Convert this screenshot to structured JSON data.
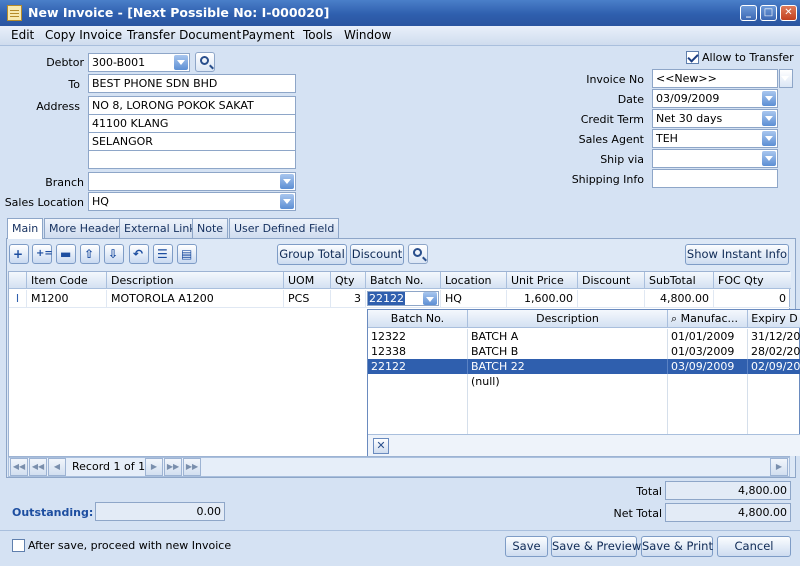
{
  "window": {
    "title": "New Invoice - [Next Possible No: I-000020]",
    "min": "_",
    "max": "□",
    "close": "✕"
  },
  "menu": [
    "Edit",
    "Copy Invoice",
    "Transfer Document",
    "Payment",
    "Tools",
    "Window"
  ],
  "header": {
    "debtor_label": "Debtor",
    "debtor": "300-B001",
    "to_label": "To",
    "to": "BEST PHONE SDN BHD",
    "address_label": "Address",
    "address": [
      "NO 8, LORONG POKOK SAKAT",
      "41100 KLANG",
      "SELANGOR",
      ""
    ],
    "branch_label": "Branch",
    "branch": "",
    "sales_location_label": "Sales Location",
    "sales_location": "HQ",
    "allow_transfer": "Allow to Transfer",
    "invoice_no_label": "Invoice No",
    "invoice_no": "<<New>>",
    "date_label": "Date",
    "date": "03/09/2009",
    "credit_term_label": "Credit Term",
    "credit_term": "Net 30 days",
    "sales_agent_label": "Sales Agent",
    "sales_agent": "TEH",
    "ship_via_label": "Ship via",
    "ship_via": "",
    "shipping_info_label": "Shipping Info",
    "shipping_info": ""
  },
  "tabs": [
    "Main",
    "More Header",
    "External Link",
    "Note",
    "User Defined Field"
  ],
  "toolbar": {
    "group_total": "Group Total",
    "discount": "Discount",
    "show_instant_info": "Show Instant Info"
  },
  "grid": {
    "columns": [
      "Item Code",
      "Description",
      "UOM",
      "Qty",
      "Batch No.",
      "Location",
      "Unit Price",
      "Discount",
      "SubTotal",
      "FOC Qty"
    ],
    "rows": [
      {
        "marker": "I",
        "item_code": "M1200",
        "description": "MOTOROLA A1200",
        "uom": "PCS",
        "qty": "3",
        "batch": "22122",
        "location": "HQ",
        "unit_price": "1,600.00",
        "discount": "",
        "subtotal": "4,800.00",
        "foc": "0"
      }
    ]
  },
  "batch_popup": {
    "columns": [
      "Batch No.",
      "Description",
      "Manufac...",
      "Expiry D"
    ],
    "rows": [
      {
        "batch": "12322",
        "desc": "BATCH A",
        "mfg": "01/01/2009",
        "exp": "31/12/20"
      },
      {
        "batch": "12338",
        "desc": "BATCH B",
        "mfg": "01/03/2009",
        "exp": "28/02/201"
      },
      {
        "batch": "22122",
        "desc": "BATCH 22",
        "mfg": "03/09/2009",
        "exp": "02/09/201"
      },
      {
        "batch": "",
        "desc": "(null)",
        "mfg": "",
        "exp": ""
      }
    ],
    "selected_index": 2
  },
  "navigator": {
    "record_text": "Record 1 of 1"
  },
  "footer": {
    "total_label": "Total",
    "total": "4,800.00",
    "outstanding_label": "Outstanding:",
    "outstanding": "0.00",
    "net_total_label": "Net Total",
    "net_total": "4,800.00",
    "after_save_label": "After save, proceed with new Invoice",
    "save": "Save",
    "save_preview": "Save & Preview",
    "save_print": "Save & Print",
    "cancel": "Cancel"
  }
}
